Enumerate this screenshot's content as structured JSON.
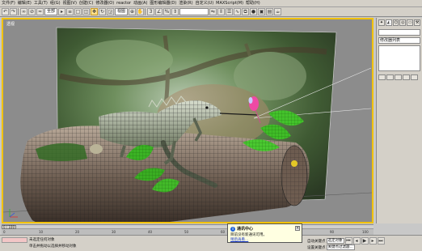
{
  "menubar": {
    "items": [
      "文件(F)",
      "编辑(E)",
      "工具(T)",
      "组(G)",
      "视图(V)",
      "创建(C)",
      "修改器(O)",
      "reactor",
      "动画(A)",
      "图形编辑器(D)",
      "渲染(R)",
      "自定义(U)",
      "MAXScript(M)",
      "帮助(H)"
    ]
  },
  "toolbar": {
    "selection_filter": "全部",
    "reference_coord": "视图",
    "named_selection": ""
  },
  "viewport": {
    "label": "透视",
    "accent_border": "#f2c200"
  },
  "command_panel": {
    "tabs": [
      "create-icon",
      "modify-icon",
      "hierarchy-icon",
      "motion-icon",
      "display-icon",
      "utilities-icon"
    ],
    "object_name": "",
    "modifier_list": "修改器列表"
  },
  "timeline": {
    "frame_indicator": "0 / 100",
    "ticks": [
      "0",
      "10",
      "20",
      "30",
      "40",
      "50",
      "60",
      "70",
      "80",
      "90",
      "100"
    ]
  },
  "status": {
    "line1": "未选定任何对象",
    "line2": "单击并拖动以选择并移动对象",
    "auto_key_label": "自动关键点",
    "selected_label": "选定对象",
    "set_key_label": "设置关键点",
    "key_filter_label": "关键点过滤器..."
  },
  "balloon": {
    "title": "通讯中心",
    "text": "目前没有新通讯可用。",
    "link": "稍后再看..."
  }
}
